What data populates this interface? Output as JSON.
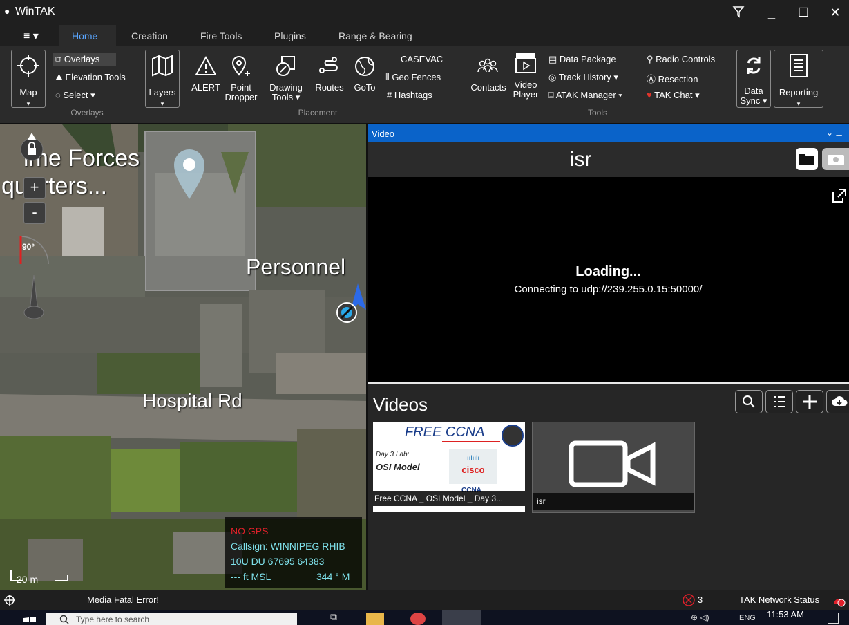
{
  "app": {
    "title": "WinTAK",
    "filter_icon": "filter-icon",
    "min": "_",
    "max": "☐",
    "close": "✕"
  },
  "ribbon": {
    "menu_label": "≡ ▾",
    "tabs": [
      "Home",
      "Creation",
      "Fire Tools",
      "Plugins",
      "Range & Bearing"
    ],
    "groups": {
      "overlays": "Overlays",
      "placement": "Placement",
      "tools": "Tools"
    },
    "map_label": "Map",
    "overlays_items": [
      "Overlays",
      "Elevation Tools",
      "Select ▾"
    ],
    "layers_label": "Layers",
    "placement_buttons": [
      "ALERT",
      "Point\nDropper",
      "Drawing\nTools ▾",
      "Routes",
      "GoTo"
    ],
    "placement_small": [
      "CASEVAC",
      "Geo Fences",
      "# Hashtags"
    ],
    "contacts_label": "Contacts",
    "video_player_label": "Video\nPlayer",
    "tools_col1": [
      "Data Package",
      "Track History ▾",
      "ATAK Manager ▾"
    ],
    "tools_col2": [
      "Radio Controls",
      "Resection",
      "TAK Chat ▾"
    ],
    "data_sync_label": "Data\nSync ▾",
    "reporting_label": "Reporting"
  },
  "map": {
    "labels": [
      "ime Forces",
      "quarters...",
      "Personnel",
      "Hospital Rd"
    ],
    "compass": "90°",
    "zoom_in": "+",
    "zoom_out": "-",
    "scale": "20 m",
    "gps_status": "NO GPS",
    "callsign": "Callsign: WINNIPEG RHIB",
    "grid": "10U  DU  67695  64383",
    "alt": "--- ft MSL",
    "heading": "344 ° M"
  },
  "video": {
    "pane_title": "Video",
    "stream_name": "isr",
    "loading": "Loading...",
    "connecting": "Connecting to udp://239.255.0.15:50000/",
    "list_title": "Videos",
    "items": [
      {
        "label": "Free CCNA _ OSI Model _ Day 3...",
        "thumb_top": "FREE CCNA",
        "thumb_line1": "Day 3 Lab:",
        "thumb_line2": "OSI Model",
        "thumb_brand": "cisco",
        "thumb_ccna": "CCNA"
      },
      {
        "label": "isr"
      }
    ]
  },
  "status": {
    "message": "Media Fatal Error!",
    "error_count": "3",
    "network": "TAK Network Status"
  },
  "taskbar": {
    "search_placeholder": "Type here to search",
    "time": "11:53 AM",
    "lang": "ENG"
  }
}
